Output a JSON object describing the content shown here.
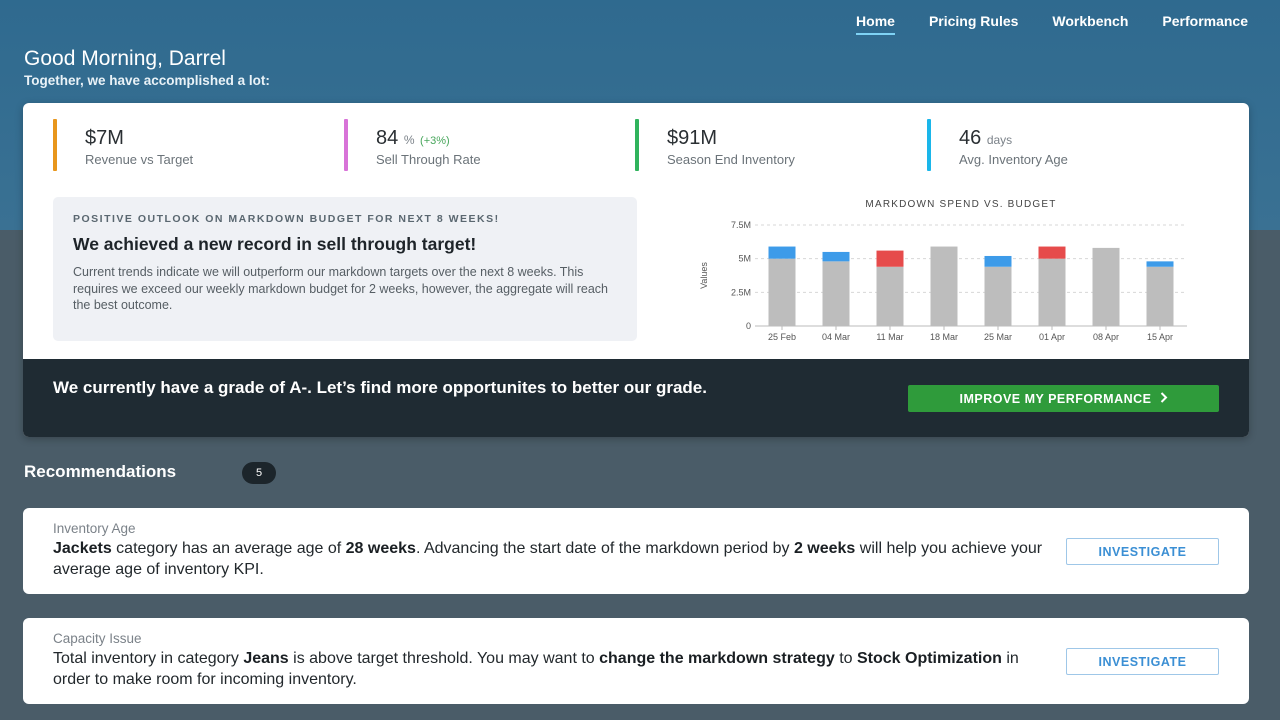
{
  "nav": {
    "items": [
      {
        "label": "Home",
        "active": true
      },
      {
        "label": "Pricing Rules",
        "active": false
      },
      {
        "label": "Workbench",
        "active": false
      },
      {
        "label": "Performance",
        "active": false
      }
    ]
  },
  "header": {
    "greeting": "Good Morning, Darrel",
    "subtitle": "Together, we have accomplished a lot:"
  },
  "kpis": [
    {
      "value": "$7M",
      "unit": "",
      "delta": "",
      "label": "Revenue vs Target",
      "color": "#e8961c"
    },
    {
      "value": "84",
      "unit": "%",
      "delta": "(+3%)",
      "label": "Sell Through Rate",
      "color": "#d873d8"
    },
    {
      "value": "$91M",
      "unit": "",
      "delta": "",
      "label": "Season End Inventory",
      "color": "#2fb35c"
    },
    {
      "value": "46",
      "unit": "days",
      "delta": "",
      "label": "Avg. Inventory Age",
      "color": "#1ab6ea"
    }
  ],
  "outlook": {
    "kicker": "POSITIVE OUTLOOK ON MARKDOWN BUDGET FOR NEXT 8 WEEKS!",
    "title": "We achieved a new record in sell through target!",
    "text": "Current trends indicate we will outperform our markdown targets over the next 8 weeks. This requires we exceed our weekly markdown budget for 2 weeks, however, the aggregate will reach the best outcome."
  },
  "chart_data": {
    "type": "bar",
    "title": "MARKDOWN SPEND VS. BUDGET",
    "ylabel": "Values",
    "ylim": [
      0,
      7.5
    ],
    "yticks": [
      "0",
      "2.5M",
      "5M",
      "7.5M"
    ],
    "ytick_values": [
      0,
      2.5,
      5,
      7.5
    ],
    "categories": [
      "25 Feb",
      "04 Mar",
      "11 Mar",
      "18 Mar",
      "25 Mar",
      "01 Apr",
      "08 Apr",
      "15 Apr"
    ],
    "base_values": [
      5.0,
      4.8,
      4.4,
      5.9,
      4.4,
      5.0,
      5.8,
      4.4
    ],
    "overlay_values": [
      0.9,
      0.7,
      1.2,
      0,
      0.8,
      0.9,
      0,
      0.4
    ],
    "overlay_colors": [
      "#3d9be9",
      "#3d9be9",
      "#e64b4b",
      "",
      "#3d9be9",
      "#e64b4b",
      "",
      "#3d9be9"
    ],
    "base_color": "#bdbdbd",
    "grid": true
  },
  "grade": {
    "text": "We currently have a grade of A-. Let’s find more opportunites to better our grade.",
    "button_label": "IMPROVE MY PERFORMANCE"
  },
  "recommendations": {
    "title": "Recommendations",
    "count": "5",
    "items": [
      {
        "category": "Inventory Age",
        "parts": [
          {
            "t": "Jackets",
            "b": true
          },
          {
            "t": " category has an average age of ",
            "b": false
          },
          {
            "t": "28 weeks",
            "b": true
          },
          {
            "t": ". Advancing the start date of the markdown period by ",
            "b": false
          },
          {
            "t": "2 weeks",
            "b": true
          },
          {
            "t": " will help you achieve your average age of inventory KPI.",
            "b": false
          }
        ],
        "button_label": "INVESTIGATE"
      },
      {
        "category": "Capacity Issue",
        "parts": [
          {
            "t": "Total inventory in category ",
            "b": false
          },
          {
            "t": "Jeans",
            "b": true
          },
          {
            "t": " is above target threshold. You may want to ",
            "b": false
          },
          {
            "t": "change the markdown strategy",
            "b": true
          },
          {
            "t": " to ",
            "b": false
          },
          {
            "t": "Stock Optimization",
            "b": true
          },
          {
            "t": " in order to make room for incoming inventory.",
            "b": false
          }
        ],
        "button_label": "INVESTIGATE"
      }
    ]
  },
  "icons": {
    "improve_chevron": "chevron-right-icon"
  }
}
